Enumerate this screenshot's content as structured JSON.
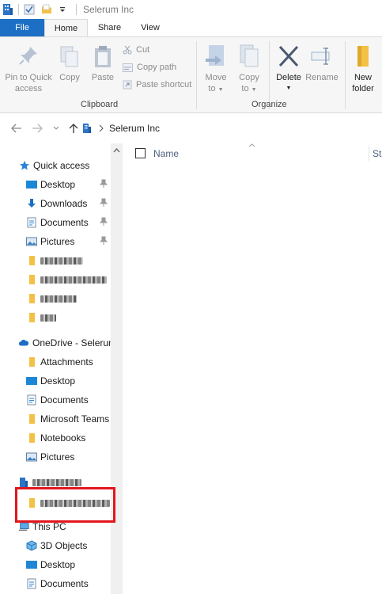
{
  "window": {
    "title": "Selerum Inc"
  },
  "ribbon_tabs": [
    "File",
    "Home",
    "Share",
    "View"
  ],
  "ribbon": {
    "pin_to_quick_access": [
      "Pin to Quick",
      "access"
    ],
    "copy": "Copy",
    "paste": "Paste",
    "cut": "Cut",
    "copy_path": "Copy path",
    "paste_shortcut": "Paste shortcut",
    "clipboard_group": "Clipboard",
    "move_to": [
      "Move",
      "to"
    ],
    "copy_to": [
      "Copy",
      "to"
    ],
    "delete": "Delete",
    "rename": "Rename",
    "organize_group": "Organize",
    "new_folder": [
      "New",
      "folder"
    ]
  },
  "address": {
    "path": [
      "Selerum Inc"
    ]
  },
  "nav": {
    "quick_access": {
      "label": "Quick access",
      "items": [
        {
          "label": "Desktop",
          "icon": "desktop-icon",
          "pinned": true
        },
        {
          "label": "Downloads",
          "icon": "downloads-icon",
          "pinned": true
        },
        {
          "label": "Documents",
          "icon": "documents-icon",
          "pinned": true
        },
        {
          "label": "Pictures",
          "icon": "pictures-icon",
          "pinned": true
        }
      ]
    },
    "onedrive": {
      "label": "OneDrive - Selerum Inc",
      "items": [
        {
          "label": "Attachments",
          "icon": "folder-icon"
        },
        {
          "label": "Desktop",
          "icon": "desktop-icon"
        },
        {
          "label": "Documents",
          "icon": "documents-icon"
        },
        {
          "label": "Microsoft Teams",
          "icon": "folder-icon"
        },
        {
          "label": "Notebooks",
          "icon": "folder-icon"
        },
        {
          "label": "Pictures",
          "icon": "pictures-icon"
        }
      ]
    },
    "this_pc": {
      "label": "This PC",
      "items": [
        {
          "label": "3D Objects",
          "icon": "3d-objects-icon"
        },
        {
          "label": "Desktop",
          "icon": "desktop-icon"
        },
        {
          "label": "Documents",
          "icon": "documents-icon"
        }
      ]
    }
  },
  "content": {
    "columns": [
      "Name",
      "St"
    ]
  },
  "colors": {
    "accent": "#1c6fc4",
    "folder": "#f3c145",
    "highlight_box": "#e2161d"
  }
}
